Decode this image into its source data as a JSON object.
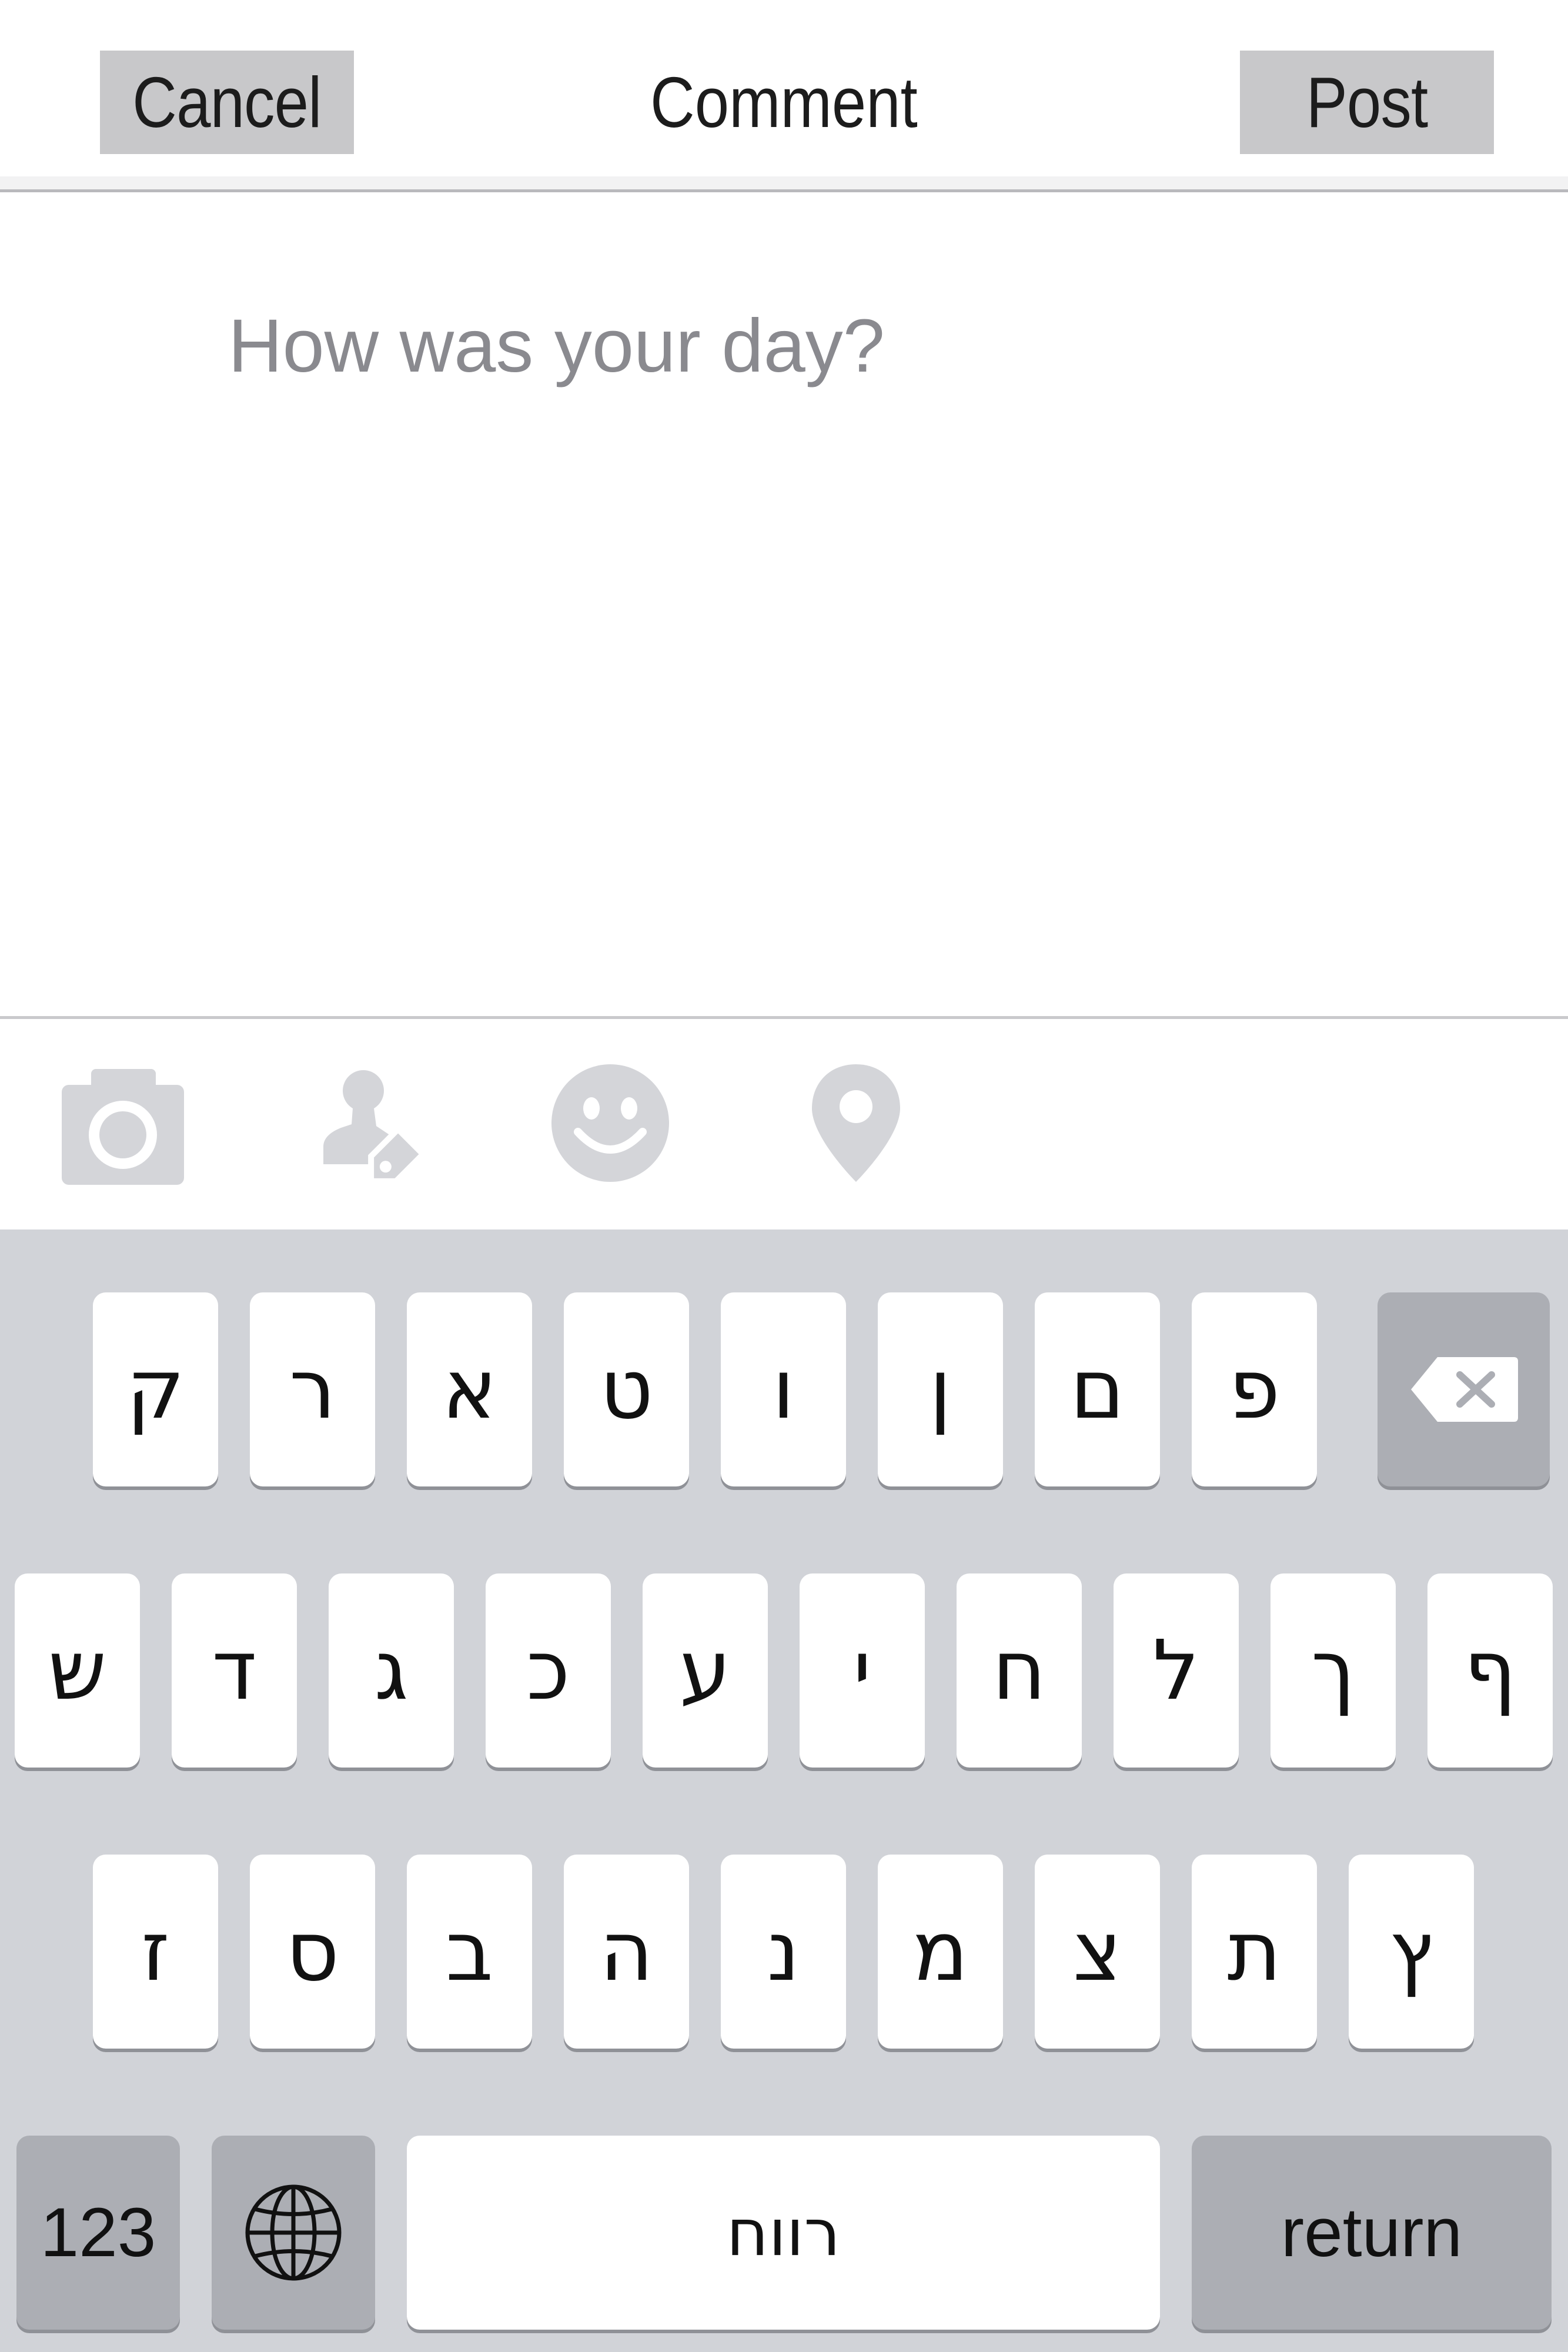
{
  "header": {
    "cancel_label": "Cancel",
    "title": "Comment",
    "post_label": "Post"
  },
  "compose": {
    "placeholder": "How was your day?"
  },
  "toolbar": {
    "icons": [
      "camera-icon",
      "tag-person-icon",
      "emoji-icon",
      "location-pin-icon"
    ],
    "icon_color": "#d4d5d9"
  },
  "keyboard": {
    "row1": [
      "ק",
      "ר",
      "א",
      "ט",
      "ו",
      "ן",
      "ם",
      "פ"
    ],
    "row2": [
      "ש",
      "ד",
      "ג",
      "כ",
      "ע",
      "י",
      "ח",
      "ל",
      "ך",
      "ף"
    ],
    "row3": [
      "ז",
      "ס",
      "ב",
      "ה",
      "נ",
      "מ",
      "צ",
      "ת",
      "ץ"
    ],
    "numbers_label": "123",
    "space_label": "רווח",
    "return_label": "return",
    "backspace_icon": "backspace-icon",
    "globe_icon": "globe-icon",
    "background": "#d1d3d8",
    "key_color": "#ffffff",
    "function_key_color": "#acaeb4"
  }
}
